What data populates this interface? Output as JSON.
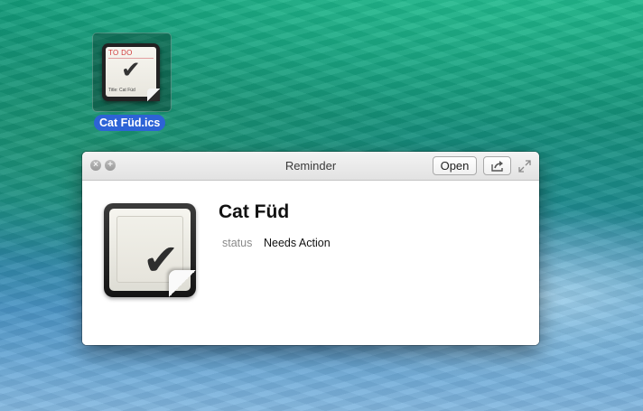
{
  "desktop": {
    "file": {
      "name": "Cat Füd.ics",
      "thumbnail_header": "TO DO",
      "thumbnail_title": "Title: Cat Füd"
    }
  },
  "window": {
    "title": "Reminder",
    "open_label": "Open",
    "share_icon": "share-icon",
    "fullscreen_icon": "fullscreen-icon",
    "close_icon": "close-icon",
    "zoom_icon": "plus-icon"
  },
  "reminder": {
    "title": "Cat Füd",
    "status_label": "status",
    "status_value": "Needs Action"
  }
}
